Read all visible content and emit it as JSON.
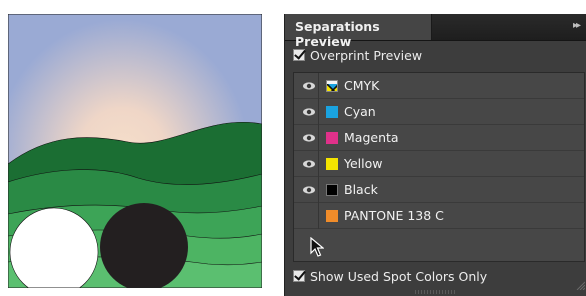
{
  "panel": {
    "title": "Separations Preview",
    "collapse_glyph": "▸▸",
    "overprint_label": "Overprint Preview",
    "overprint_checked": true,
    "show_used_label": "Show Used Spot Colors Only",
    "show_used_checked": true
  },
  "separations": [
    {
      "name": "CMYK",
      "color": "#f5f5f5",
      "visible": true,
      "icon": "cmyk-composite-icon"
    },
    {
      "name": "Cyan",
      "color": "#1aa3e0",
      "visible": true,
      "icon": "eye-icon"
    },
    {
      "name": "Magenta",
      "color": "#e0318a",
      "visible": true,
      "icon": "eye-icon"
    },
    {
      "name": "Yellow",
      "color": "#f4e400",
      "visible": true,
      "icon": "eye-icon"
    },
    {
      "name": "Black",
      "color": "#000000",
      "visible": true,
      "icon": "eye-icon"
    },
    {
      "name": "PANTONE 138 C",
      "color": "#f08c2a",
      "visible": false,
      "icon": ""
    }
  ],
  "artwork_colors": {
    "sky": "#9aaad4",
    "sun_glow": "#f3dcc6",
    "hill_dark": "#1d7a3a",
    "hill_mid": "#2f9650",
    "hill_light": "#58b468",
    "circle_white": "#ffffff",
    "circle_black": "#231f20"
  }
}
